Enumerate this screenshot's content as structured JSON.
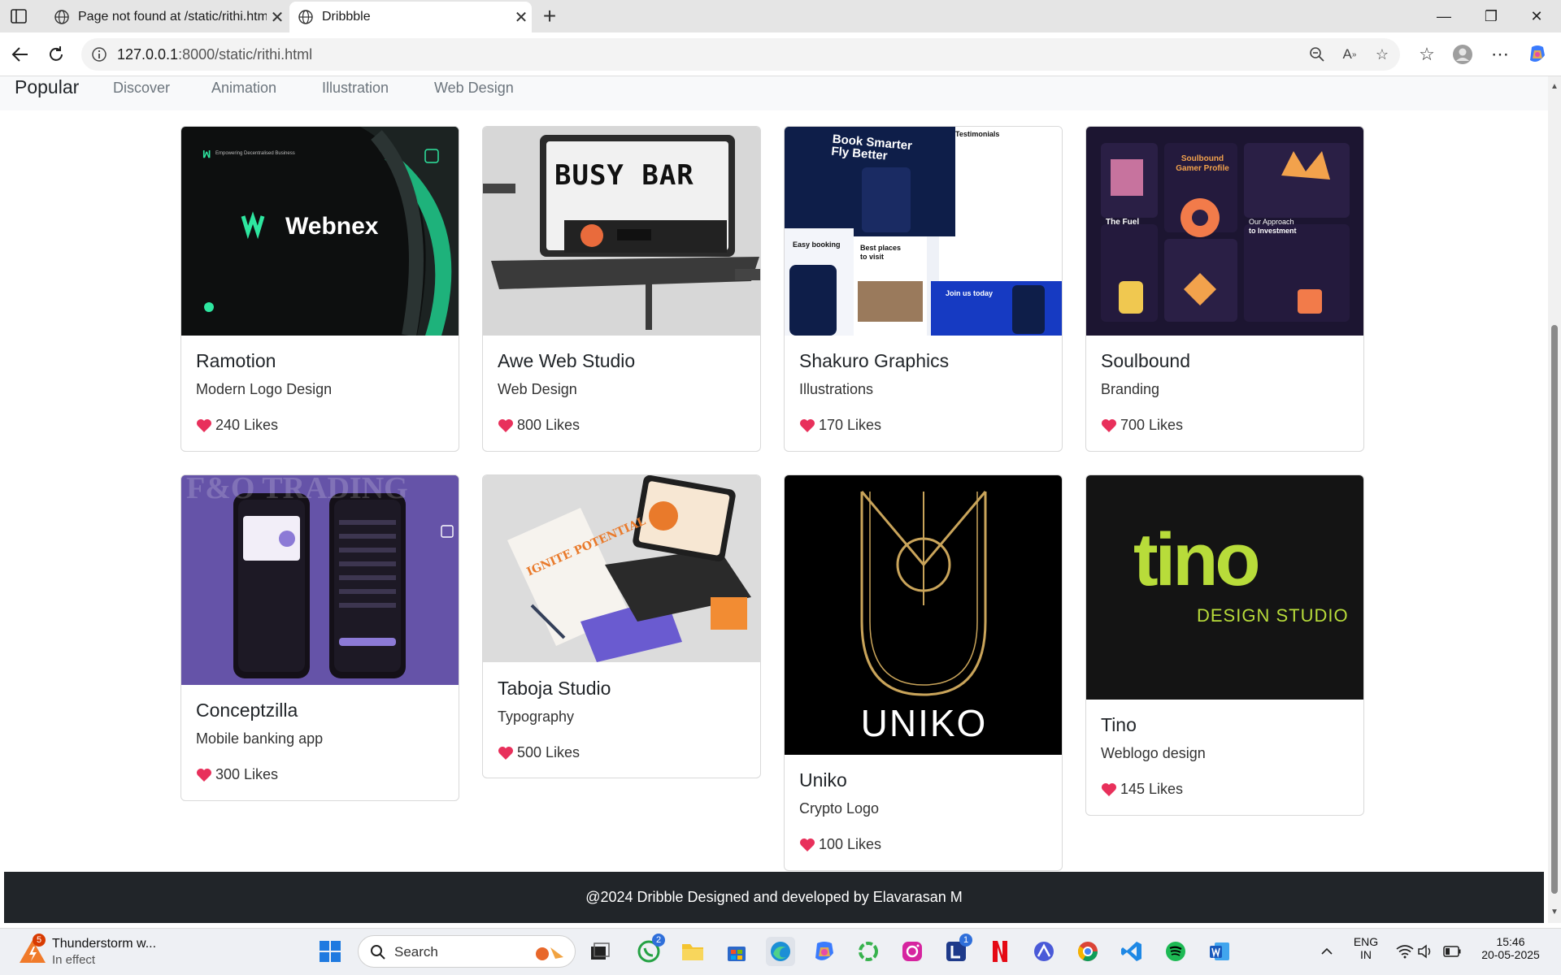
{
  "browser": {
    "tabs": [
      {
        "title": "Page not found at /static/rithi.htm",
        "active": false
      },
      {
        "title": "Dribbble",
        "active": true
      }
    ],
    "url_host": "127.0.0.1",
    "url_rest": ":8000/static/rithi.html"
  },
  "nav": {
    "active": "Popular",
    "items": [
      "Discover",
      "Animation",
      "Illustration",
      "Web Design"
    ]
  },
  "cards": [
    {
      "title": "Ramotion",
      "subtitle": "Modern Logo Design",
      "likes": "240 Likes",
      "thumb_text": "Webnex"
    },
    {
      "title": "Awe Web Studio",
      "subtitle": "Web Design",
      "likes": "800 Likes",
      "thumb_text": "BUSY BAR"
    },
    {
      "title": "Shakuro Graphics",
      "subtitle": "Illustrations",
      "likes": "170 Likes",
      "thumb_text": "Book Smarter Fly Better"
    },
    {
      "title": "Soulbound",
      "subtitle": "Branding",
      "likes": "700 Likes",
      "thumb_text": "Soulbound Gamer Profile"
    },
    {
      "title": "Conceptzilla",
      "subtitle": "Mobile banking app",
      "likes": "300 Likes",
      "thumb_text": "F&O TRADING"
    },
    {
      "title": "Taboja Studio",
      "subtitle": "Typography",
      "likes": "500 Likes",
      "thumb_text": "IGNITE POTENTIAL"
    },
    {
      "title": "Uniko",
      "subtitle": "Crypto Logo",
      "likes": "100 Likes",
      "thumb_text": "UNIKO"
    },
    {
      "title": "Tino",
      "subtitle": "Weblogo design",
      "likes": "145 Likes",
      "thumb_text": "tino",
      "thumb_sub": "DESIGN STUDIO"
    }
  ],
  "footer": "@2024 Dribble Designed and developed by Elavarasan M",
  "taskbar": {
    "weather_title": "Thunderstorm w...",
    "weather_sub": "In effect",
    "weather_badge": "5",
    "search_label": "Search",
    "whatsapp_badge": "2",
    "l_badge": "1",
    "lang_1": "ENG",
    "lang_2": "IN",
    "time": "15:46",
    "date": "20-05-2025"
  },
  "colors": {
    "heart": "#e8305b",
    "footer_bg": "#212529",
    "nav_bg": "#f8f9fa"
  }
}
